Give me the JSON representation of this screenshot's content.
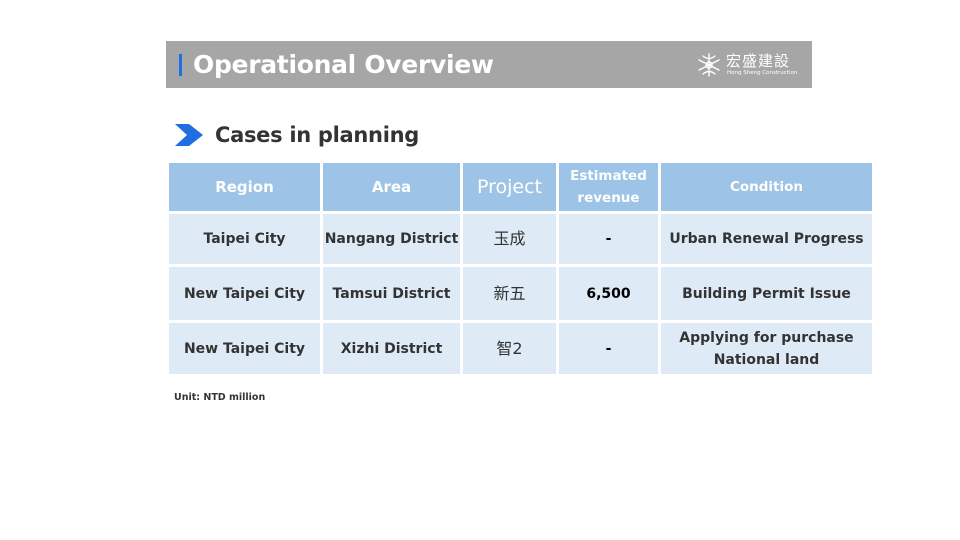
{
  "header": {
    "title": "Operational Overview",
    "logo_cn": "宏盛建設",
    "logo_en": "Hong Sheng Construction",
    "logo_icon": "company-logo-icon"
  },
  "section": {
    "title": "Cases in planning",
    "bullet_icon": "chevron-right-icon"
  },
  "table": {
    "headers": [
      "Region",
      "Area",
      "Project",
      "Estimated revenue",
      "Condition"
    ],
    "rows": [
      [
        "Taipei City",
        "Nangang District",
        "玉成",
        "-",
        "Urban Renewal Progress"
      ],
      [
        "New Taipei City",
        "Tamsui District",
        "新五",
        "6,500",
        "Building Permit Issue"
      ],
      [
        "New Taipei City",
        "Xizhi District",
        "智2",
        "-",
        "Applying for purchase National land"
      ]
    ]
  },
  "footnote": "Unit: NTD million",
  "colors": {
    "title_bar": "#a6a6a6",
    "accent": "#1f6fe0",
    "header_cell": "#9dc3e6",
    "body_cell": "#deebf7"
  }
}
